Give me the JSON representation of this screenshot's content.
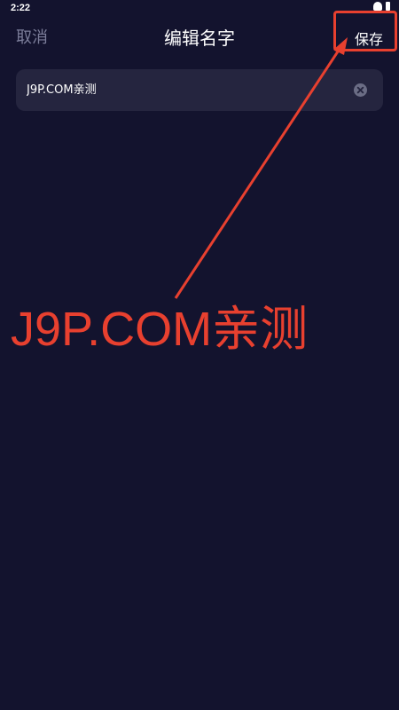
{
  "status_bar": {
    "time": "2:22"
  },
  "nav": {
    "cancel_label": "取消",
    "title": "编辑名字",
    "save_label": "保存"
  },
  "name_field": {
    "value": "J9P.COM亲测"
  },
  "watermark": {
    "text": "J9P.COM亲测"
  },
  "colors": {
    "background": "#13132e",
    "field_background": "#25253f",
    "annotation_red": "#e8402f",
    "muted_text": "#7c7e9a"
  }
}
